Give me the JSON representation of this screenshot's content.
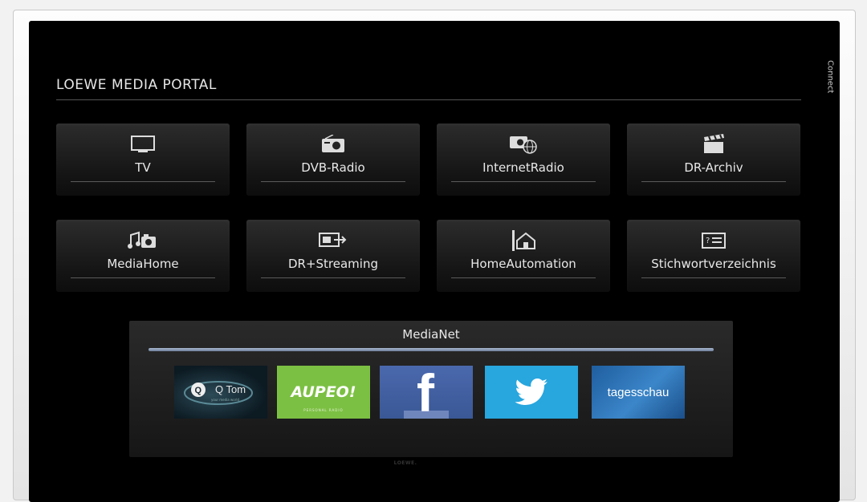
{
  "portal": {
    "title": "LOEWE MEDIA PORTAL",
    "side_label": "Connect"
  },
  "tiles": [
    {
      "label": "TV",
      "icon": "tv-icon"
    },
    {
      "label": "DVB-Radio",
      "icon": "radio-icon"
    },
    {
      "label": "InternetRadio",
      "icon": "internet-radio-icon"
    },
    {
      "label": "DR-Archiv",
      "icon": "clapperboard-icon"
    },
    {
      "label": "MediaHome",
      "icon": "media-home-icon"
    },
    {
      "label": "DR+Streaming",
      "icon": "streaming-icon"
    },
    {
      "label": "HomeAutomation",
      "icon": "home-automation-icon"
    },
    {
      "label": "Stichwortverzeichnis",
      "icon": "index-icon"
    }
  ],
  "medianet": {
    "title": "MediaNet",
    "apps": [
      {
        "name": "Q Tom",
        "subtitle": "your media world",
        "icon": "qtom-logo"
      },
      {
        "name": "AUPEO!",
        "subtitle": "PERSONAL RADIO",
        "icon": "aupeo-logo"
      },
      {
        "name": "f",
        "icon": "facebook-logo"
      },
      {
        "name": "",
        "icon": "twitter-bird-icon"
      },
      {
        "name": "tagesschau",
        "icon": "tagesschau-logo"
      }
    ]
  },
  "brand": "LOEWE.",
  "colors": {
    "screen_bg": "#000000",
    "tile_bg": "#222222",
    "medianet_bar": "#8d9db8",
    "aupeo": "#7cc043",
    "facebook": "#3b5998",
    "twitter": "#28a6de",
    "tagesschau": "#2b6db2"
  }
}
